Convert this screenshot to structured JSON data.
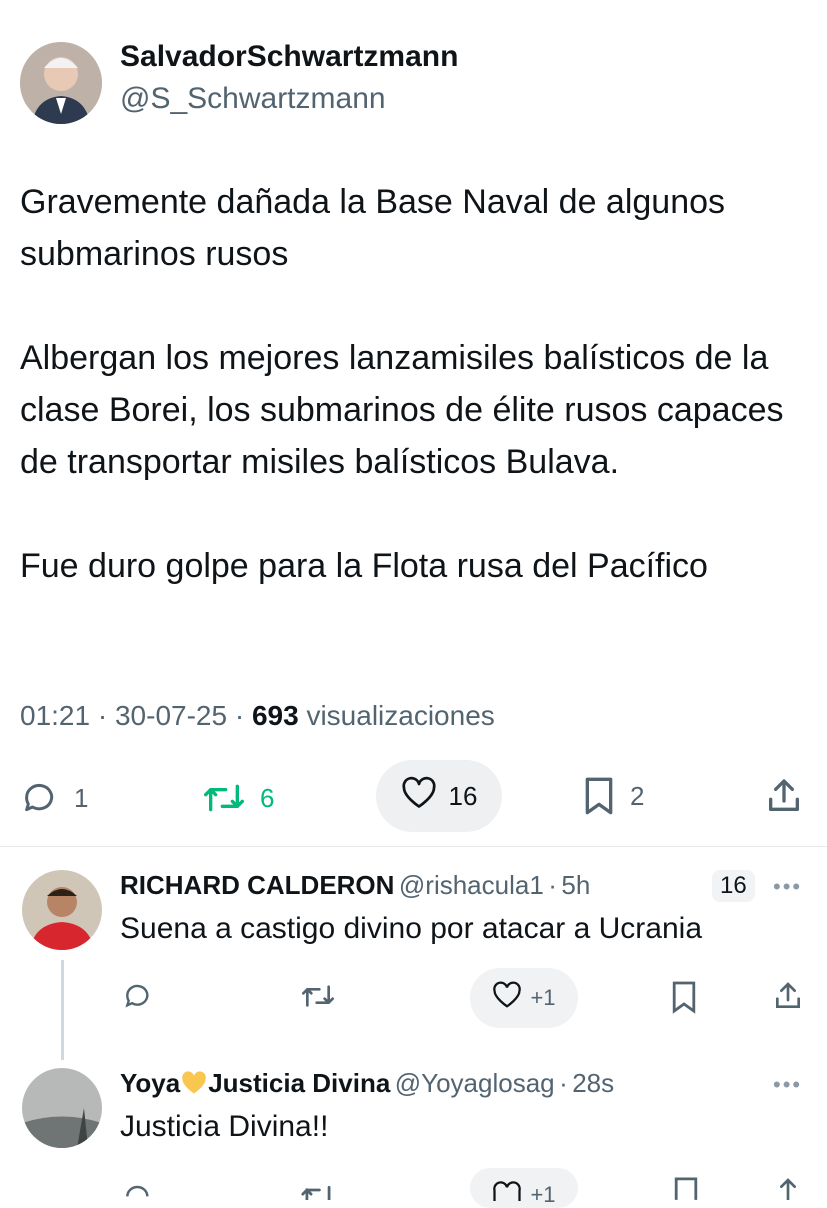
{
  "author": {
    "name": "SalvadorSchwartzmann",
    "handle": "@S_Schwartzmann"
  },
  "tweet": {
    "text": "Gravemente dañada la  Base Naval de algunos submarinos rusos\n\nAlbergan los mejores lanzamisiles balísticos de la clase Borei, los submarinos de élite rusos capaces de transportar misiles balísticos Bulava.\n\nFue duro golpe para la Flota rusa del Pacífico",
    "time": "01:21",
    "date": "30-07-25",
    "views": "693",
    "views_label": "visualizaciones"
  },
  "actions": {
    "replies": "1",
    "retweets": "6",
    "likes": "16",
    "bookmarks": "2"
  },
  "replies": [
    {
      "name": "RICHARD CALDERON",
      "handle": "@rishacula1",
      "time": "5h",
      "badge": "16",
      "text": "Suena a castigo divino por atacar a Ucrania",
      "like_label": "+1"
    },
    {
      "name_before": "Yoya",
      "name_after": "Justicia Divina",
      "handle": "@Yoyaglosag",
      "time": "28s",
      "text": "Justicia Divina!!",
      "like_label": "+1"
    }
  ],
  "colors": {
    "text": "#0f1419",
    "secondary": "#536471",
    "retweet_green": "#00ba7c",
    "heart_yellow": "#f9c74f"
  },
  "icons": [
    "reply-icon",
    "retweet-icon",
    "heart-icon",
    "bookmark-icon",
    "share-icon",
    "more-icon",
    "yellow-heart-icon"
  ]
}
